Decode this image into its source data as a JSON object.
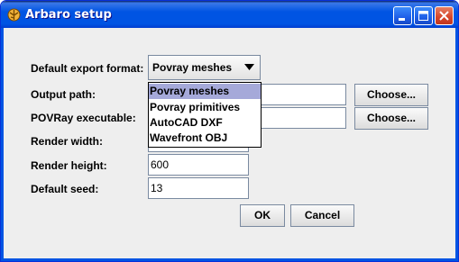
{
  "window": {
    "title": "Arbaro setup",
    "buttons": [
      "minimize",
      "maximize",
      "close"
    ]
  },
  "form": {
    "export_format_label": "Default export format:",
    "export_format_value": "Povray meshes",
    "output_path_label": "Output path:",
    "output_path_value": "",
    "povray_exe_label": "POVRay executable:",
    "povray_exe_value": "",
    "choose_label_1": "Choose...",
    "choose_label_2": "Choose...",
    "render_width_label": "Render width:",
    "render_height_label": "Render height:",
    "render_height_value": "600",
    "default_seed_label": "Default seed:",
    "default_seed_value": "13"
  },
  "dropdown": {
    "options": [
      "Povray meshes",
      "Povray primitives",
      "AutoCAD DXF",
      "Wavefront OBJ"
    ],
    "selected": "Povray meshes"
  },
  "actions": {
    "ok_label": "OK",
    "cancel_label": "Cancel"
  },
  "colors": {
    "titlebar": "#0054e3",
    "dialog_bg": "#eeeeee",
    "selected_option": "#a5a9d9"
  }
}
